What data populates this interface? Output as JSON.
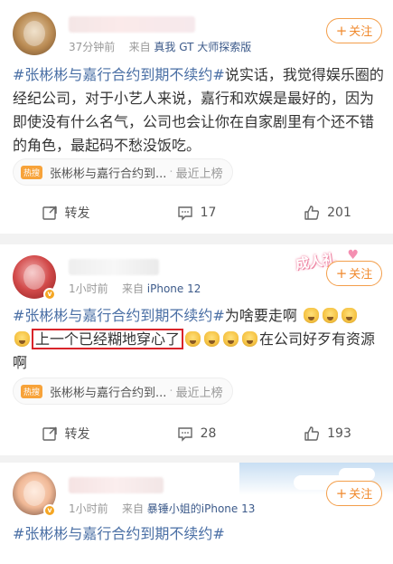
{
  "posts": [
    {
      "meta_time": "37分钟前",
      "meta_from": "来自",
      "meta_source": "真我 GT 大师探索版",
      "follow_label": "关注",
      "hashtag": "#张彬彬与嘉行合约到期不续约#",
      "text": "说实话，我觉得娱乐圈的经纪公司，对于小艺人来说，嘉行和欢娱是最好的，因为即使没有什么名气，公司也会让你在自家剧里有个还不错的角色，最起码不愁没饭吃。",
      "hot_badge": "热搜",
      "hot_title": "张彬彬与嘉行合约到...",
      "hot_sub": "最近上榜",
      "repost_label": "转发",
      "comment_count": "17",
      "like_count": "201"
    },
    {
      "meta_time": "1小时前",
      "meta_from": "来自",
      "meta_source": "iPhone 12",
      "follow_label": "关注",
      "sticker_text": "成人礼",
      "hashtag": "#张彬彬与嘉行合约到期不续约#",
      "text_a": "为啥要走啊",
      "highlight": "上一个已经糊地穿心了",
      "text_b": "在公司好歹有资源啊",
      "hot_badge": "热搜",
      "hot_title": "张彬彬与嘉行合约到...",
      "hot_sub": "最近上榜",
      "repost_label": "转发",
      "comment_count": "28",
      "like_count": "193"
    },
    {
      "meta_time": "1小时前",
      "meta_from": "来自",
      "meta_source": "暴锤小姐的iPhone 13",
      "follow_label": "关注",
      "hashtag": "#张彬彬与嘉行合约到期不续约#"
    }
  ],
  "colors": {
    "accent": "#f08a2e",
    "hashtag": "#4a6fa5",
    "highlight_border": "#d9242a",
    "source_link": "#3c5a8a"
  },
  "icons": [
    "repost-icon",
    "comment-icon",
    "like-icon",
    "emoji-icon",
    "verified-badge-icon"
  ]
}
